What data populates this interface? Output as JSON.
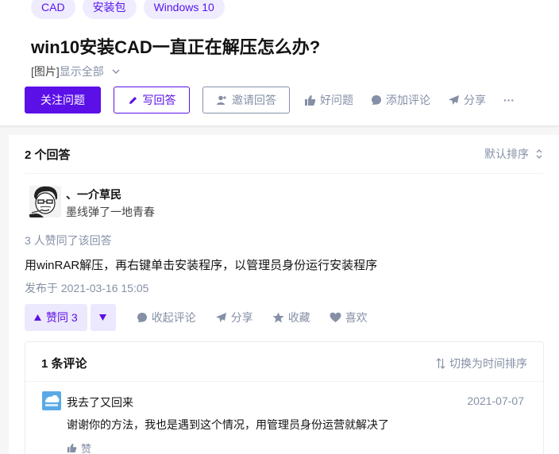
{
  "question": {
    "tags": [
      "CAD",
      "安装包",
      "Windows 10"
    ],
    "title": "win10安装CAD一直正在解压怎么办?",
    "detail_prefix": "[图片]",
    "show_all": "显示全部",
    "actions": {
      "follow": "关注问题",
      "write": "写回答",
      "invite": "邀请回答",
      "good": "好问题",
      "comment": "添加评论",
      "share": "分享",
      "more": "···"
    }
  },
  "answers": {
    "count_label": "2 个回答",
    "sort_label": "默认排序",
    "item": {
      "author_name": "、一介草民",
      "author_bio": "墨线弹了一地青春",
      "voters": "3 人赞同了该回答",
      "content": "用winRAR解压，再右键单击安装程序，以管理员身份运行安装程序",
      "published": "发布于 2021-03-16 15:05",
      "actions": {
        "upvote": "赞同 3",
        "collapse_comments": "收起评论",
        "share": "分享",
        "favorite": "收藏",
        "like": "喜欢"
      }
    }
  },
  "comments": {
    "count_label": "1 条评论",
    "switch_sort": "切换为时间排序",
    "items": [
      {
        "user": "我去了又回来",
        "date": "2021-07-07",
        "text": "谢谢你的方法，我也是遇到这个情况，用管理员身份运营就解决了",
        "like": "赞"
      }
    ]
  },
  "colors": {
    "brand": "#5b10e8",
    "muted": "#8590a6",
    "tag_bg": "#f0ecff"
  }
}
